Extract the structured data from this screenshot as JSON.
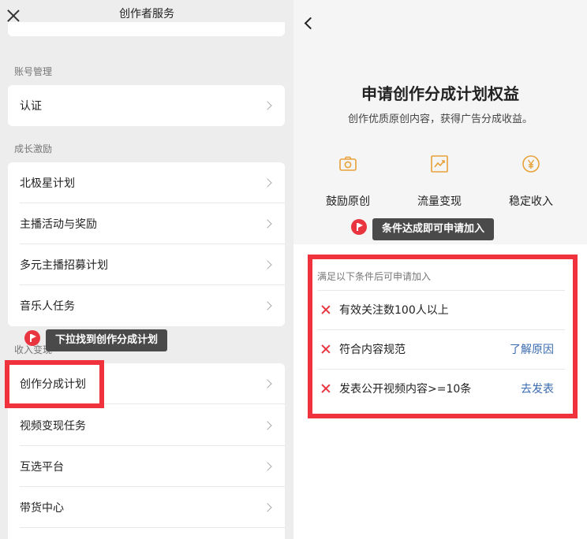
{
  "left": {
    "title": "创作者服务",
    "sections": {
      "account": {
        "label": "账号管理",
        "items": [
          "认证"
        ]
      },
      "growth": {
        "label": "成长激励",
        "items": [
          "北极星计划",
          "主播活动与奖励",
          "多元主播招募计划",
          "音乐人任务"
        ]
      },
      "income": {
        "label": "收入变现",
        "items": [
          "创作分成计划",
          "视频变现任务",
          "互选平台",
          "带货中心"
        ]
      }
    },
    "tooltip": "下拉找到创作分成计划"
  },
  "right": {
    "title": "申请创作分成计划权益",
    "subtitle": "创作优质原创内容，获得广告分成收益。",
    "features": [
      {
        "label": "鼓励原创",
        "icon": "camera-icon"
      },
      {
        "label": "流量变现",
        "icon": "trend-chart-icon"
      },
      {
        "label": "稳定收入",
        "icon": "yen-icon"
      }
    ],
    "tooltip": "条件达成即可申请加入",
    "conditions_header": "满足以下条件后可申请加入",
    "conditions": [
      {
        "text": "有效关注数100人以上",
        "link": ""
      },
      {
        "text": "符合内容规范",
        "link": "了解原因"
      },
      {
        "text": "发表公开视频内容>=10条",
        "link": "去发表"
      }
    ]
  },
  "colors": {
    "accent_red": "#f0323c",
    "icon_orange": "#e8a23a",
    "link_blue": "#3a6bb0"
  }
}
